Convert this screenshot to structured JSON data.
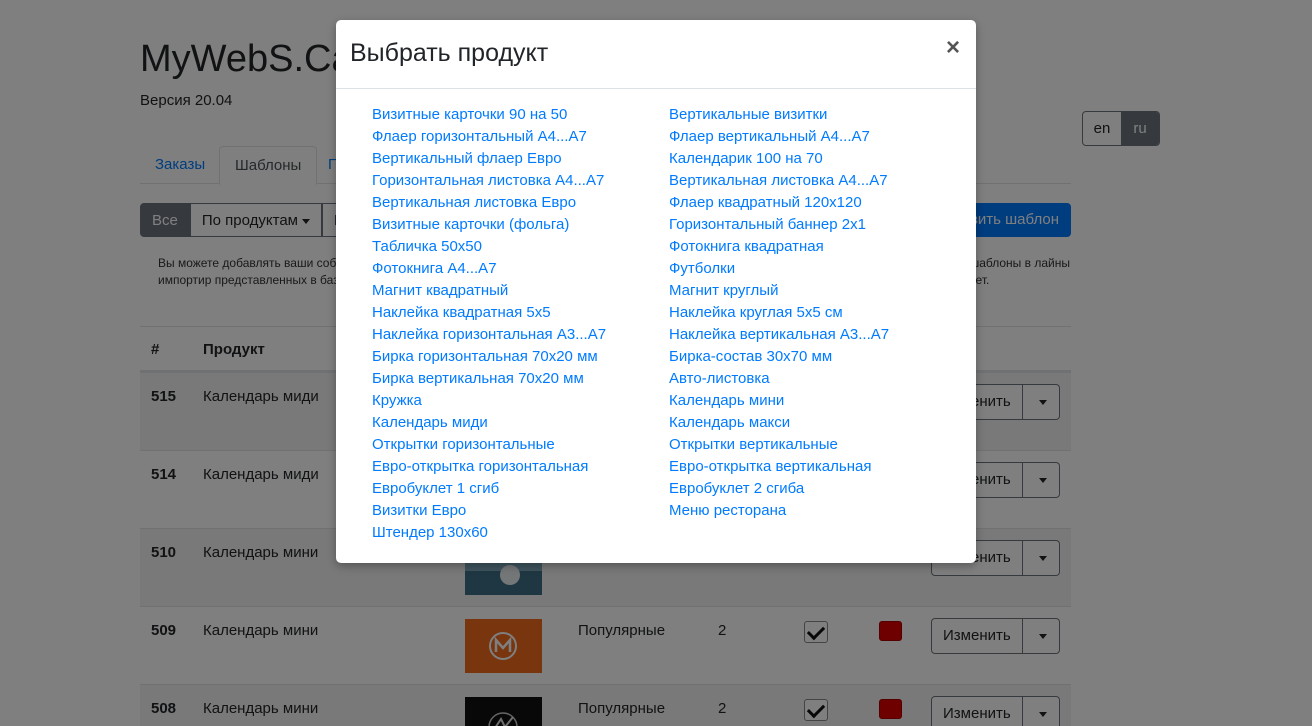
{
  "app": {
    "brand": "MyWebS.Ca",
    "version": "Версия 20.04"
  },
  "lang": [
    "en",
    "ru"
  ],
  "tabs": {
    "orders": "Заказы",
    "templates": "Шаблоны",
    "third": "П"
  },
  "filter": {
    "all": "Все",
    "by_product": "По продуктам",
    "third": "П"
  },
  "add_template": "вить шаблон",
  "info": {
    "left": "Вы можете добавлять ваши собс онлайн редакторе или импортир представленных в базе и скорр",
    "right": "ь шаблоны в лайны из ет."
  },
  "table": {
    "headers": {
      "num": "#",
      "product": "Продукт"
    },
    "edit_label": "Изменить",
    "rows": [
      {
        "id": "515",
        "product": "Календарь миди",
        "category": "",
        "count": ""
      },
      {
        "id": "514",
        "product": "Календарь миди",
        "category": "",
        "count": ""
      },
      {
        "id": "510",
        "product": "Календарь мини",
        "category": "",
        "count": ""
      },
      {
        "id": "509",
        "product": "Календарь мини",
        "category": "Популярные",
        "count": "2"
      },
      {
        "id": "508",
        "product": "Календарь мини",
        "category": "Популярные",
        "count": "2"
      }
    ]
  },
  "modal": {
    "title": "Выбрать продукт",
    "close": "×",
    "left": [
      "Визитные карточки 90 на 50",
      "Флаер горизонтальный А4...А7",
      "Вертикальный флаер Евро",
      "Горизонтальная листовка А4...А7",
      "Вертикальная листовка Евро",
      "Визитные карточки (фольга)",
      "Табличка 50х50",
      "Фотокнига А4...А7",
      "Магнит квадратный",
      "Наклейка квадратная 5х5",
      "Наклейка горизонтальная А3...А7",
      "Бирка горизонтальная 70х20 мм",
      "Бирка вертикальная 70х20 мм",
      "Кружка",
      "Календарь миди",
      "Открытки горизонтальные",
      "Евро-открытка горизонтальная",
      "Евробуклет 1 сгиб",
      "Визитки Евро",
      "Штендер 130х60"
    ],
    "right": [
      "Вертикальные визитки",
      "Флаер вертикальный А4...А7",
      "Календарик 100 на 70",
      "Вертикальная листовка А4...А7",
      "Флаер квадратный 120х120",
      "Горизонтальный баннер 2х1",
      "Фотокнига квадратная",
      "Футболки",
      "Магнит круглый",
      "Наклейка круглая 5х5 см",
      "Наклейка вертикальная А3...А7",
      "Бирка-состав 30х70 мм",
      "Авто-листовка",
      "Календарь мини",
      "Календарь макси",
      "Открытки вертикальные",
      "Евро-открытка вертикальная",
      "Евробуклет 2 сгиба",
      "Меню ресторана"
    ]
  },
  "colors": {
    "link": "#007bff",
    "primary": "#007bff",
    "secondary": "#6c757d",
    "swatch": "#dd0000"
  }
}
